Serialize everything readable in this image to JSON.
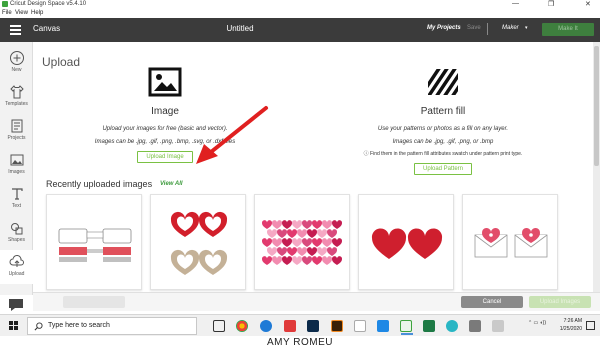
{
  "window": {
    "app_title": "Cricut Design Space  v5.4.10",
    "minimize": "—",
    "restore": "❐",
    "close": "✕"
  },
  "menu": [
    "File",
    "View",
    "Help"
  ],
  "topbar": {
    "section": "Canvas",
    "doc_title": "Untitled",
    "my_projects": "My Projects",
    "save": "Save",
    "machine": "Maker",
    "make_it": "Make It",
    "caret": "▾"
  },
  "sidebar": {
    "items": [
      {
        "label": "New",
        "icon": "plus-icon"
      },
      {
        "label": "Templates",
        "icon": "shirt-icon"
      },
      {
        "label": "Projects",
        "icon": "projects-icon"
      },
      {
        "label": "Images",
        "icon": "images-icon"
      },
      {
        "label": "Text",
        "icon": "text-icon"
      },
      {
        "label": "Shapes",
        "icon": "shapes-icon"
      },
      {
        "label": "Upload",
        "icon": "upload-icon"
      }
    ],
    "active": "Upload"
  },
  "main": {
    "heading": "Upload",
    "image_col": {
      "title": "Image",
      "desc": "Upload your images for free (basic and vector).",
      "formats": "Images can be .jpg, .gif, .png, .bmp, .svg, or .dxf files",
      "button": "Upload Image"
    },
    "pattern_col": {
      "title": "Pattern fill",
      "desc": "Use your patterns or photos as a fill on any layer.",
      "formats": "Images can be .jpg, .gif, .png, or .bmp",
      "hint": "ⓘ Find them in the pattern fill attributes swatch under pattern print type.",
      "button": "Upload Pattern"
    },
    "recent_heading": "Recently uploaded images",
    "view_all": "View All",
    "thumbnails": [
      {
        "name": "glasses-tags"
      },
      {
        "name": "heart-frames"
      },
      {
        "name": "pink-hearts-pattern"
      },
      {
        "name": "red-hearts"
      },
      {
        "name": "heart-envelopes"
      }
    ]
  },
  "bottom": {
    "cancel": "Cancel",
    "upload": "Upload Images"
  },
  "taskbar": {
    "search_placeholder": "Type here to search",
    "time": "7:26 AM",
    "date": "1/25/2020"
  },
  "credit": "AMY ROMEU",
  "colors": {
    "topbar": "#3b3b3b",
    "accent_green": "#7ac143",
    "arrow_red": "#e02020",
    "heart_red": "#cf1f2e"
  }
}
